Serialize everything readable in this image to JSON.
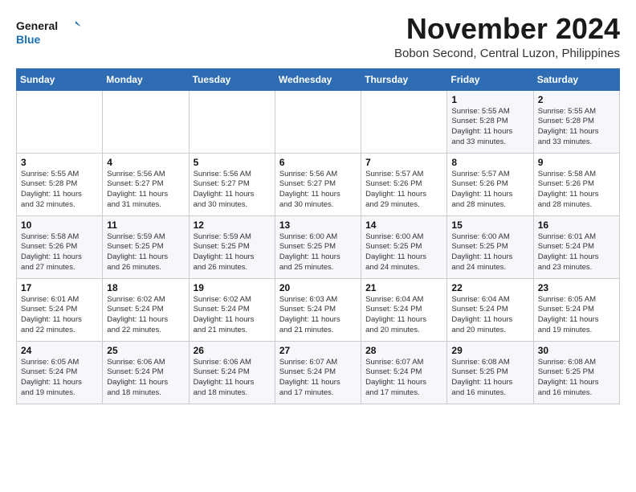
{
  "logo": {
    "line1": "General",
    "line2": "Blue",
    "icon_color": "#1a6fb5"
  },
  "header": {
    "month_year": "November 2024",
    "location": "Bobon Second, Central Luzon, Philippines"
  },
  "weekdays": [
    "Sunday",
    "Monday",
    "Tuesday",
    "Wednesday",
    "Thursday",
    "Friday",
    "Saturday"
  ],
  "weeks": [
    [
      {
        "day": "",
        "info": ""
      },
      {
        "day": "",
        "info": ""
      },
      {
        "day": "",
        "info": ""
      },
      {
        "day": "",
        "info": ""
      },
      {
        "day": "",
        "info": ""
      },
      {
        "day": "1",
        "info": "Sunrise: 5:55 AM\nSunset: 5:28 PM\nDaylight: 11 hours\nand 33 minutes."
      },
      {
        "day": "2",
        "info": "Sunrise: 5:55 AM\nSunset: 5:28 PM\nDaylight: 11 hours\nand 33 minutes."
      }
    ],
    [
      {
        "day": "3",
        "info": "Sunrise: 5:55 AM\nSunset: 5:28 PM\nDaylight: 11 hours\nand 32 minutes."
      },
      {
        "day": "4",
        "info": "Sunrise: 5:56 AM\nSunset: 5:27 PM\nDaylight: 11 hours\nand 31 minutes."
      },
      {
        "day": "5",
        "info": "Sunrise: 5:56 AM\nSunset: 5:27 PM\nDaylight: 11 hours\nand 30 minutes."
      },
      {
        "day": "6",
        "info": "Sunrise: 5:56 AM\nSunset: 5:27 PM\nDaylight: 11 hours\nand 30 minutes."
      },
      {
        "day": "7",
        "info": "Sunrise: 5:57 AM\nSunset: 5:26 PM\nDaylight: 11 hours\nand 29 minutes."
      },
      {
        "day": "8",
        "info": "Sunrise: 5:57 AM\nSunset: 5:26 PM\nDaylight: 11 hours\nand 28 minutes."
      },
      {
        "day": "9",
        "info": "Sunrise: 5:58 AM\nSunset: 5:26 PM\nDaylight: 11 hours\nand 28 minutes."
      }
    ],
    [
      {
        "day": "10",
        "info": "Sunrise: 5:58 AM\nSunset: 5:26 PM\nDaylight: 11 hours\nand 27 minutes."
      },
      {
        "day": "11",
        "info": "Sunrise: 5:59 AM\nSunset: 5:25 PM\nDaylight: 11 hours\nand 26 minutes."
      },
      {
        "day": "12",
        "info": "Sunrise: 5:59 AM\nSunset: 5:25 PM\nDaylight: 11 hours\nand 26 minutes."
      },
      {
        "day": "13",
        "info": "Sunrise: 6:00 AM\nSunset: 5:25 PM\nDaylight: 11 hours\nand 25 minutes."
      },
      {
        "day": "14",
        "info": "Sunrise: 6:00 AM\nSunset: 5:25 PM\nDaylight: 11 hours\nand 24 minutes."
      },
      {
        "day": "15",
        "info": "Sunrise: 6:00 AM\nSunset: 5:25 PM\nDaylight: 11 hours\nand 24 minutes."
      },
      {
        "day": "16",
        "info": "Sunrise: 6:01 AM\nSunset: 5:24 PM\nDaylight: 11 hours\nand 23 minutes."
      }
    ],
    [
      {
        "day": "17",
        "info": "Sunrise: 6:01 AM\nSunset: 5:24 PM\nDaylight: 11 hours\nand 22 minutes."
      },
      {
        "day": "18",
        "info": "Sunrise: 6:02 AM\nSunset: 5:24 PM\nDaylight: 11 hours\nand 22 minutes."
      },
      {
        "day": "19",
        "info": "Sunrise: 6:02 AM\nSunset: 5:24 PM\nDaylight: 11 hours\nand 21 minutes."
      },
      {
        "day": "20",
        "info": "Sunrise: 6:03 AM\nSunset: 5:24 PM\nDaylight: 11 hours\nand 21 minutes."
      },
      {
        "day": "21",
        "info": "Sunrise: 6:04 AM\nSunset: 5:24 PM\nDaylight: 11 hours\nand 20 minutes."
      },
      {
        "day": "22",
        "info": "Sunrise: 6:04 AM\nSunset: 5:24 PM\nDaylight: 11 hours\nand 20 minutes."
      },
      {
        "day": "23",
        "info": "Sunrise: 6:05 AM\nSunset: 5:24 PM\nDaylight: 11 hours\nand 19 minutes."
      }
    ],
    [
      {
        "day": "24",
        "info": "Sunrise: 6:05 AM\nSunset: 5:24 PM\nDaylight: 11 hours\nand 19 minutes."
      },
      {
        "day": "25",
        "info": "Sunrise: 6:06 AM\nSunset: 5:24 PM\nDaylight: 11 hours\nand 18 minutes."
      },
      {
        "day": "26",
        "info": "Sunrise: 6:06 AM\nSunset: 5:24 PM\nDaylight: 11 hours\nand 18 minutes."
      },
      {
        "day": "27",
        "info": "Sunrise: 6:07 AM\nSunset: 5:24 PM\nDaylight: 11 hours\nand 17 minutes."
      },
      {
        "day": "28",
        "info": "Sunrise: 6:07 AM\nSunset: 5:24 PM\nDaylight: 11 hours\nand 17 minutes."
      },
      {
        "day": "29",
        "info": "Sunrise: 6:08 AM\nSunset: 5:25 PM\nDaylight: 11 hours\nand 16 minutes."
      },
      {
        "day": "30",
        "info": "Sunrise: 6:08 AM\nSunset: 5:25 PM\nDaylight: 11 hours\nand 16 minutes."
      }
    ]
  ]
}
